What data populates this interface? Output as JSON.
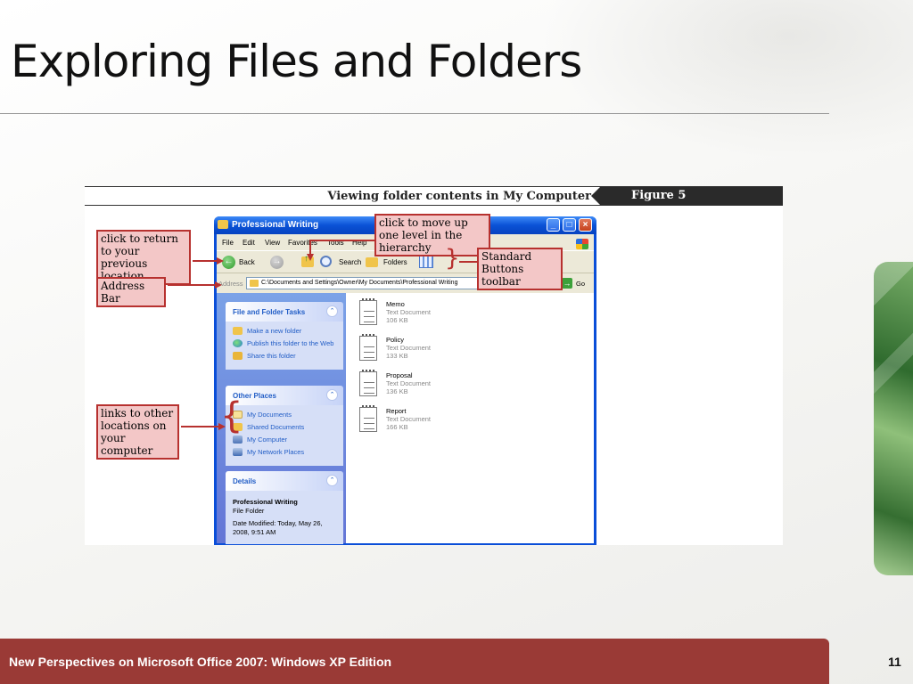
{
  "slide": {
    "title": "Exploring Files and Folders",
    "footer": "New Perspectives on Microsoft Office 2007: Windows XP Edition",
    "page_number": "11"
  },
  "figure": {
    "caption": "Viewing folder contents in My Computer",
    "label": "Figure 5"
  },
  "window": {
    "title": "Professional Writing",
    "menu": [
      "File",
      "Edit",
      "View",
      "Favorites",
      "Tools",
      "Help"
    ],
    "toolbar": {
      "back": "Back",
      "search": "Search",
      "folders": "Folders"
    },
    "address": {
      "label": "Address",
      "value": "C:\\Documents and Settings\\Owner\\My Documents\\Professional Writing",
      "go": "Go"
    },
    "panels": {
      "tasks": {
        "title": "File and Folder Tasks",
        "items": [
          "Make a new folder",
          "Publish this folder to the Web",
          "Share this folder"
        ]
      },
      "places": {
        "title": "Other Places",
        "items": [
          "My Documents",
          "Shared Documents",
          "My Computer",
          "My Network Places"
        ]
      },
      "details": {
        "title": "Details",
        "name": "Professional Writing",
        "type": "File Folder",
        "modified": "Date Modified: Today, May 26, 2008, 9:51 AM"
      }
    },
    "files": [
      {
        "name": "Memo",
        "type": "Text Document",
        "size": "106 KB"
      },
      {
        "name": "Policy",
        "type": "Text Document",
        "size": "133 KB"
      },
      {
        "name": "Proposal",
        "type": "Text Document",
        "size": "136 KB"
      },
      {
        "name": "Report",
        "type": "Text Document",
        "size": "166 KB"
      }
    ]
  },
  "callouts": {
    "back": "click to return to your previous location",
    "address_bar": "Address Bar",
    "up": "click to move up one level in the hierarchy",
    "toolbar": "Standard Buttons toolbar",
    "links": "links to other locations on your computer"
  },
  "colors": {
    "callout_border": "#b7312f",
    "callout_fill": "#f3c7c7",
    "footer_bg": "#9a3a36",
    "xp_blue": "#0a4ed8"
  }
}
